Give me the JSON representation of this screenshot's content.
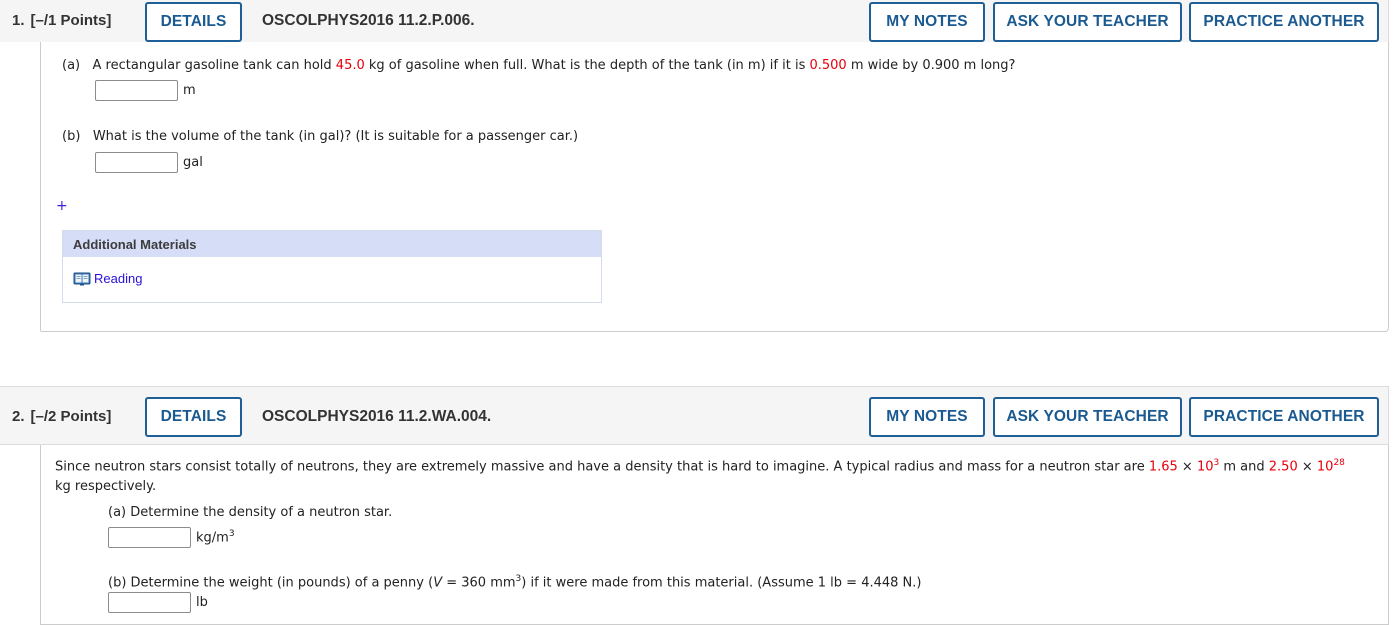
{
  "questions": [
    {
      "number": "1.",
      "points": "[–/1 Points]",
      "details_label": "DETAILS",
      "id": "OSCOLPHYS2016 11.2.P.006.",
      "my_notes_label": "MY NOTES",
      "ask_teacher_label": "ASK YOUR TEACHER",
      "practice_label": "PRACTICE ANOTHER",
      "part_a": {
        "label": "(a)",
        "text_1": "A rectangular gasoline tank can hold ",
        "value_1": "45.0",
        "text_2": " kg of gasoline when full. What is the depth of the tank (in m) if it is ",
        "value_2": "0.500",
        "text_3": " m wide by 0.900 m long?",
        "answer_value": "",
        "unit": "m"
      },
      "part_b": {
        "label": "(b)",
        "text": "What is the volume of the tank (in gal)? (It is suitable for a passenger car.)",
        "answer_value": "",
        "unit": "gal"
      },
      "plus_icon": "+",
      "additional_materials": {
        "title": "Additional Materials",
        "links": [
          {
            "icon": "book-icon",
            "label": "Reading"
          }
        ]
      }
    },
    {
      "number": "2.",
      "points": "[–/2 Points]",
      "details_label": "DETAILS",
      "id": "OSCOLPHYS2016 11.2.WA.004.",
      "my_notes_label": "MY NOTES",
      "ask_teacher_label": "ASK YOUR TEACHER",
      "practice_label": "PRACTICE ANOTHER",
      "intro": {
        "text_1": "Since neutron stars consist totally of neutrons, they are extremely massive and have a density that is hard to imagine. A typical radius and mass for a neutron star are ",
        "radius_mantissa": "1.65",
        "times": " × ",
        "radius_base": "10",
        "radius_exp": "3",
        "text_2": " m and ",
        "mass_mantissa": "2.50",
        "mass_base": "10",
        "mass_exp": "28",
        "text_3": "kg respectively."
      },
      "part_a": {
        "text": "(a) Determine the density of a neutron star.",
        "answer_value": "",
        "unit": "kg/m",
        "unit_exp": "3"
      },
      "part_b": {
        "text_1": "(b) Determine the weight (in pounds) of a penny (",
        "var": "V",
        "text_2": " = 360 mm",
        "exp": "3",
        "text_3": ") if it were made from this material. (Assume 1 lb = 4.448 N.)",
        "answer_value": "",
        "unit": "lb"
      }
    }
  ]
}
